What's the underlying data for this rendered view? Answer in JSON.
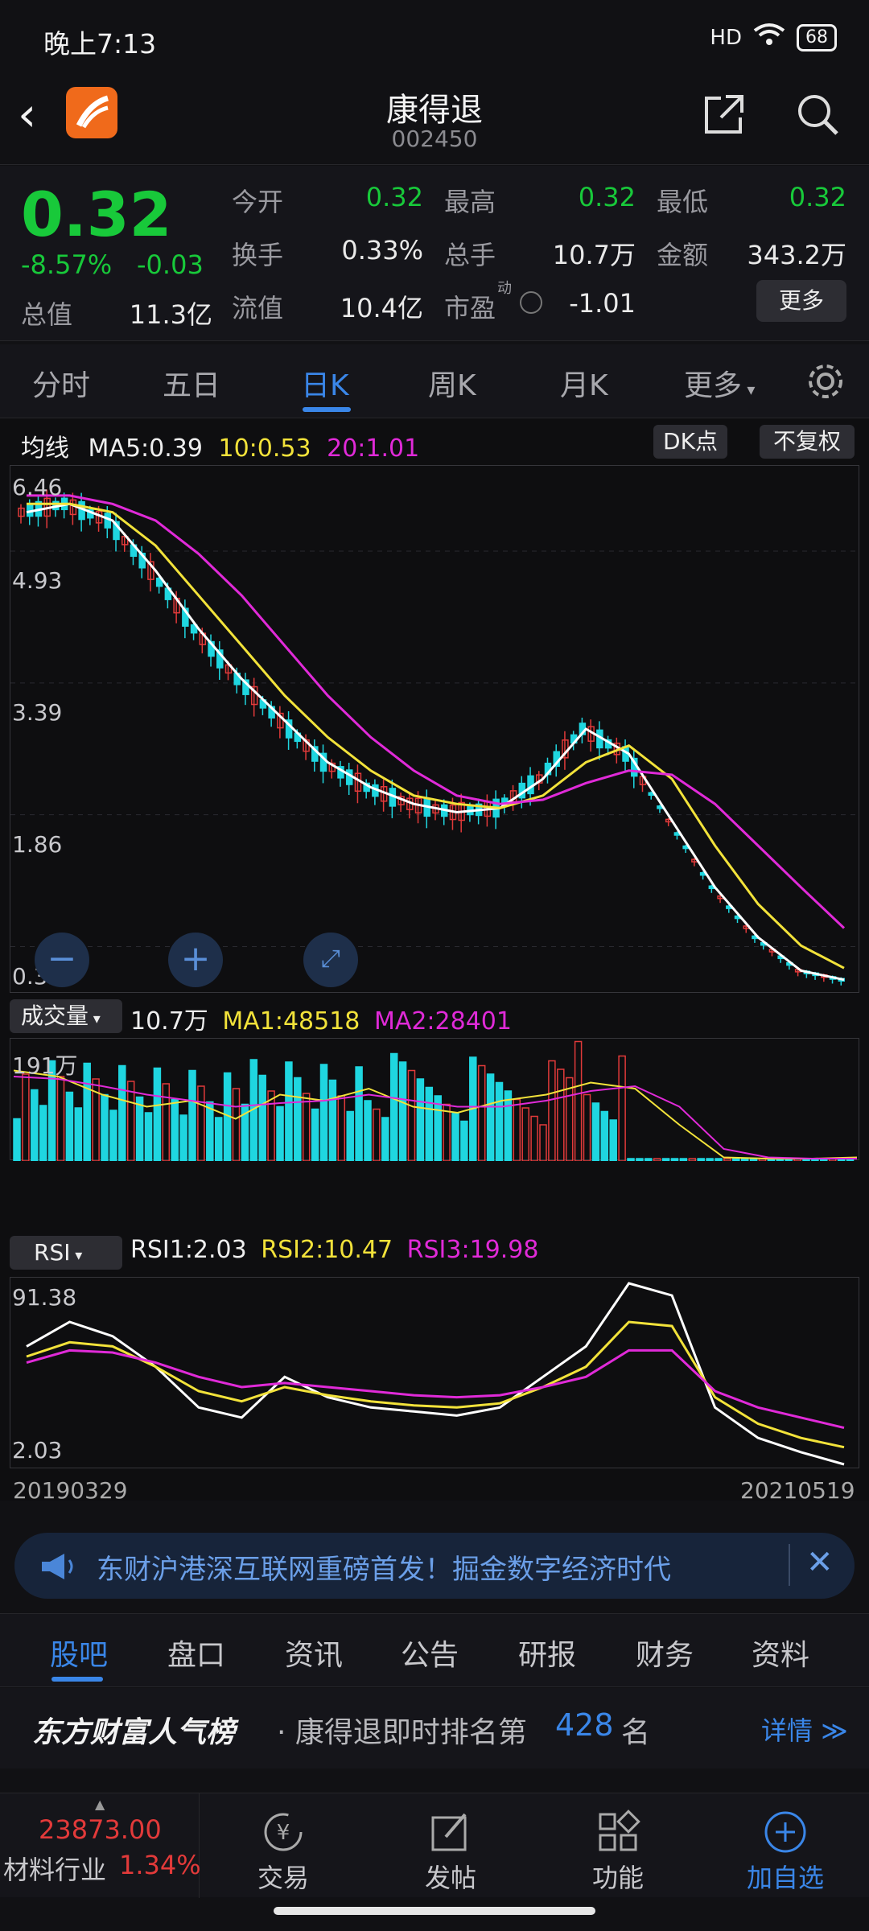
{
  "status_bar": {
    "time": "晚上7:13",
    "signal": "HD",
    "battery": "68"
  },
  "header": {
    "name": "康得退",
    "code": "002450"
  },
  "quote": {
    "price": "0.32",
    "change_pct": "-8.57%",
    "change_amt": "-0.03",
    "market_cap_label": "总值",
    "market_cap": "11.3亿",
    "fields": [
      {
        "label": "今开",
        "value": "0.32"
      },
      {
        "label": "最高",
        "value": "0.32"
      },
      {
        "label": "最低",
        "value": "0.32"
      },
      {
        "label": "换手",
        "value": "0.33%"
      },
      {
        "label": "总手",
        "value": "10.7万"
      },
      {
        "label": "金额",
        "value": "343.2万"
      },
      {
        "label": "流值",
        "value": "10.4亿"
      },
      {
        "label": "市盈",
        "value": "-1.01"
      }
    ],
    "pe_superscript": "动",
    "more_button": "更多"
  },
  "tabs": [
    "分时",
    "五日",
    "日K",
    "周K",
    "月K",
    "更多"
  ],
  "kline": {
    "ma_label": "均线",
    "ma5": "MA5:0.39",
    "ma10": "10:0.53",
    "ma20": "20:1.01",
    "dk_button": "DK点",
    "adjust_button": "不复权",
    "y_labels": [
      "6.46",
      "4.93",
      "3.39",
      "1.86",
      "0.32"
    ]
  },
  "volume": {
    "selector": "成交量",
    "value": "10.7万",
    "ma1": "MA1:48518",
    "ma2": "MA2:28401",
    "y_label": "191万"
  },
  "rsi": {
    "selector": "RSI",
    "rsi1": "RSI1:2.03",
    "rsi2": "RSI2:10.47",
    "rsi3": "RSI3:19.98",
    "y_top": "91.38",
    "y_bottom": "2.03"
  },
  "date_range": {
    "start": "20190329",
    "end": "20210519"
  },
  "banner": {
    "text": "东财沪港深互联网重磅首发！掘金数字经济时代"
  },
  "bottom_tabs": [
    "股吧",
    "盘口",
    "资讯",
    "公告",
    "研报",
    "财务",
    "资料"
  ],
  "rank": {
    "brand": "东方财富人气榜",
    "text": "· 康得退即时排名第",
    "number": "428",
    "unit": "名",
    "detail": "详情"
  },
  "toolbar": {
    "index_value": "23873.00",
    "industry": "材料行业",
    "industry_pct": "1.34%",
    "items": [
      "交易",
      "发帖",
      "功能",
      "加自选"
    ]
  },
  "colors": {
    "up": "#e23a3a",
    "down": "#18c93a",
    "candle_down": "#1fd6e0",
    "accent": "#3a86e8",
    "ma5": "#ffffff",
    "ma10": "#f2e23a",
    "ma20": "#e02ad8"
  },
  "chart_data": [
    {
      "type": "line",
      "title": "日K",
      "series": [
        {
          "name": "MA5",
          "values": [
            6.0,
            6.1,
            5.9,
            5.3,
            4.6,
            4.0,
            3.5,
            3.0,
            2.7,
            2.5,
            2.4,
            2.45,
            2.8,
            3.4,
            3.1,
            2.3,
            1.5,
            0.9,
            0.5,
            0.39
          ]
        },
        {
          "name": "10",
          "values": [
            6.1,
            6.1,
            6.0,
            5.6,
            5.0,
            4.4,
            3.8,
            3.3,
            2.9,
            2.6,
            2.5,
            2.45,
            2.6,
            3.0,
            3.2,
            2.8,
            2.0,
            1.3,
            0.8,
            0.53
          ]
        },
        {
          "name": "20",
          "values": [
            6.2,
            6.2,
            6.1,
            5.9,
            5.5,
            5.0,
            4.4,
            3.8,
            3.3,
            2.9,
            2.6,
            2.5,
            2.55,
            2.75,
            2.9,
            2.85,
            2.5,
            2.0,
            1.5,
            1.01
          ]
        }
      ],
      "ylim": [
        0.32,
        6.46
      ]
    },
    {
      "type": "bar",
      "title": "成交量",
      "series": [
        {
          "name": "MA1",
          "values": []
        },
        {
          "name": "MA2",
          "values": []
        }
      ],
      "ylim": [
        0,
        191
      ]
    },
    {
      "type": "line",
      "title": "RSI",
      "series": [
        {
          "name": "RSI1",
          "values": [
            60,
            72,
            65,
            50,
            30,
            25,
            45,
            35,
            30,
            28,
            26,
            30,
            45,
            60,
            91,
            85,
            30,
            15,
            8,
            2.03
          ]
        },
        {
          "name": "RSI2",
          "values": [
            55,
            62,
            60,
            50,
            38,
            33,
            40,
            36,
            33,
            31,
            30,
            32,
            40,
            50,
            72,
            70,
            35,
            22,
            15,
            10.47
          ]
        },
        {
          "name": "RSI3",
          "values": [
            52,
            58,
            57,
            52,
            45,
            40,
            42,
            40,
            38,
            36,
            35,
            36,
            40,
            45,
            58,
            58,
            38,
            30,
            25,
            19.98
          ]
        }
      ],
      "ylim": [
        2.03,
        91.38
      ]
    }
  ]
}
